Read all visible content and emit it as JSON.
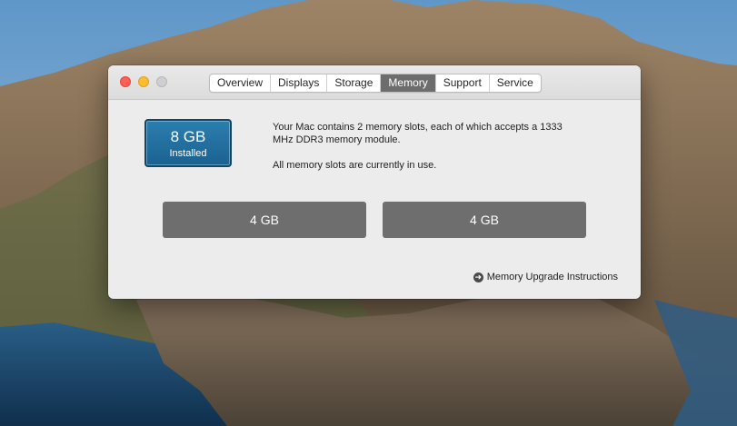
{
  "window": {
    "tabs": [
      {
        "label": "Overview"
      },
      {
        "label": "Displays"
      },
      {
        "label": "Storage"
      },
      {
        "label": "Memory"
      },
      {
        "label": "Support"
      },
      {
        "label": "Service"
      }
    ],
    "active_tab": "Memory"
  },
  "memory": {
    "installed_size": "8 GB",
    "installed_label": "Installed",
    "description": "Your Mac contains 2 memory slots, each of which accepts a 1333 MHz DDR3 memory module.",
    "status": "All memory slots are currently in use.",
    "slots": [
      {
        "label": "4 GB"
      },
      {
        "label": "4 GB"
      }
    ],
    "upgrade_link": "Memory Upgrade Instructions"
  },
  "colors": {
    "badge": "#1f6b99",
    "slot": "#6e6e6e",
    "active_tab": "#6d6d6d",
    "close": "#fe5f57",
    "minimize": "#febc2e"
  },
  "icons": {
    "close": "close-button",
    "minimize": "minimize-button",
    "zoom": "zoom-button",
    "link_arrow": "arrow-right-circle-icon"
  }
}
